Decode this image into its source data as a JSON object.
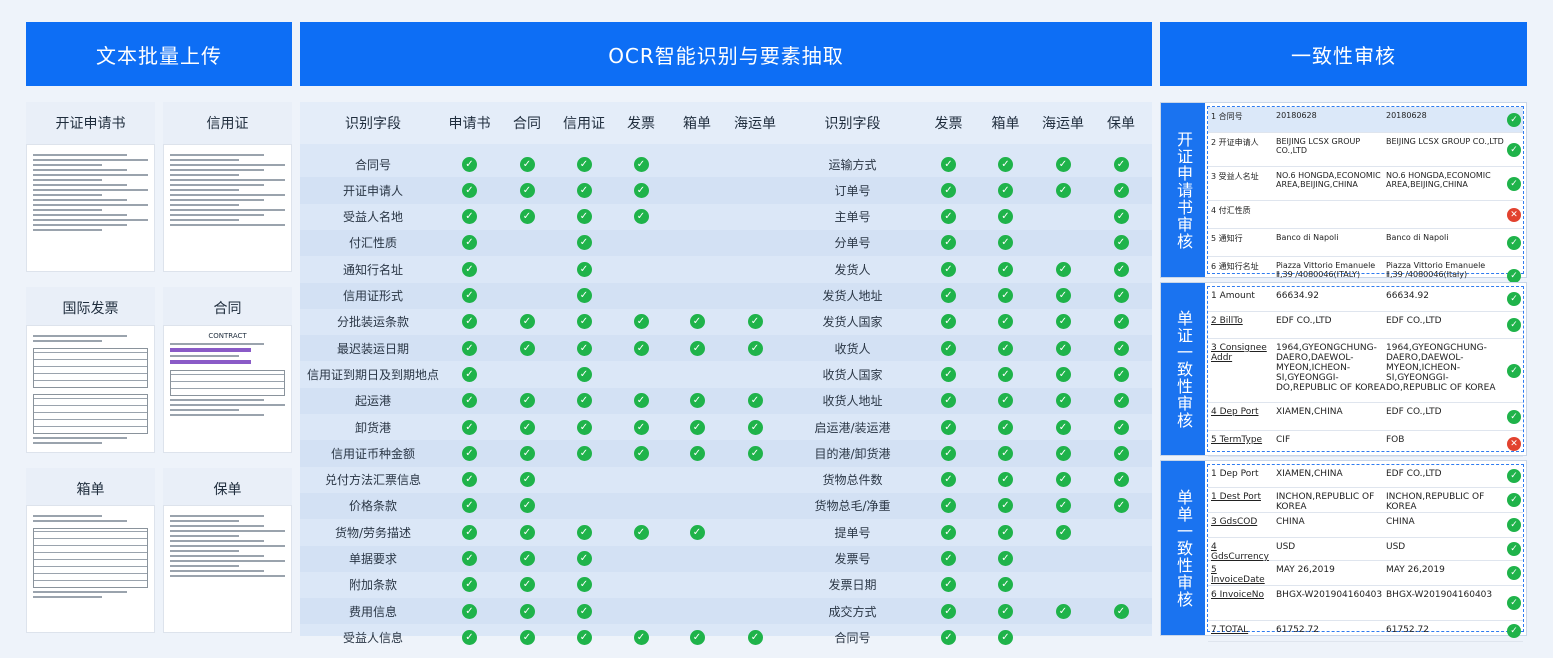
{
  "banners": {
    "upload": "文本批量上传",
    "ocr": "OCR智能识别与要素抽取",
    "review": "一致性审核"
  },
  "docs": [
    {
      "label": "开证申请书"
    },
    {
      "label": "信用证"
    },
    {
      "label": "国际发票"
    },
    {
      "label": "合同"
    },
    {
      "label": "箱单"
    },
    {
      "label": "保单"
    }
  ],
  "doc_text": {
    "contract_title": "CONTRACT"
  },
  "left_table": {
    "headers": [
      "识别字段",
      "申请书",
      "合同",
      "信用证",
      "发票",
      "箱单",
      "海运单"
    ],
    "rows": [
      {
        "field": "合同号",
        "checks": [
          1,
          1,
          1,
          1,
          0,
          0
        ]
      },
      {
        "field": "开证申请人",
        "checks": [
          1,
          1,
          1,
          1,
          0,
          0
        ]
      },
      {
        "field": "受益人名地",
        "checks": [
          1,
          1,
          1,
          1,
          0,
          0
        ]
      },
      {
        "field": "付汇性质",
        "checks": [
          1,
          0,
          1,
          0,
          0,
          0
        ]
      },
      {
        "field": "通知行名址",
        "checks": [
          1,
          0,
          1,
          0,
          0,
          0
        ]
      },
      {
        "field": "信用证形式",
        "checks": [
          1,
          0,
          1,
          0,
          0,
          0
        ]
      },
      {
        "field": "分批装运条款",
        "checks": [
          1,
          1,
          1,
          1,
          1,
          1
        ]
      },
      {
        "field": "最迟装运日期",
        "checks": [
          1,
          1,
          1,
          1,
          1,
          1
        ]
      },
      {
        "field": "信用证到期日及到期地点",
        "checks": [
          1,
          0,
          1,
          0,
          0,
          0
        ]
      },
      {
        "field": "起运港",
        "checks": [
          1,
          1,
          1,
          1,
          1,
          1
        ]
      },
      {
        "field": "卸货港",
        "checks": [
          1,
          1,
          1,
          1,
          1,
          1
        ]
      },
      {
        "field": "信用证币种金额",
        "checks": [
          1,
          1,
          1,
          1,
          1,
          1
        ]
      },
      {
        "field": "兑付方法汇票信息",
        "checks": [
          1,
          1,
          0,
          0,
          0,
          0
        ]
      },
      {
        "field": "价格条款",
        "checks": [
          1,
          1,
          0,
          0,
          0,
          0
        ]
      },
      {
        "field": "货物/劳务描述",
        "checks": [
          1,
          1,
          1,
          1,
          1,
          0
        ]
      },
      {
        "field": "单据要求",
        "checks": [
          1,
          1,
          1,
          0,
          0,
          0
        ]
      },
      {
        "field": "附加条款",
        "checks": [
          1,
          1,
          1,
          0,
          0,
          0
        ]
      },
      {
        "field": "费用信息",
        "checks": [
          1,
          1,
          1,
          0,
          0,
          0
        ]
      },
      {
        "field": "受益人信息",
        "checks": [
          1,
          1,
          1,
          1,
          1,
          1
        ]
      }
    ]
  },
  "right_table": {
    "headers": [
      "识别字段",
      "发票",
      "箱单",
      "海运单",
      "保单"
    ],
    "rows": [
      {
        "field": "运输方式",
        "checks": [
          1,
          1,
          1,
          1
        ]
      },
      {
        "field": "订单号",
        "checks": [
          1,
          1,
          1,
          1
        ]
      },
      {
        "field": "主单号",
        "checks": [
          1,
          1,
          0,
          1
        ]
      },
      {
        "field": "分单号",
        "checks": [
          1,
          1,
          0,
          1
        ]
      },
      {
        "field": "发货人",
        "checks": [
          1,
          1,
          1,
          1
        ]
      },
      {
        "field": "发货人地址",
        "checks": [
          1,
          1,
          1,
          1
        ]
      },
      {
        "field": "发货人国家",
        "checks": [
          1,
          1,
          1,
          1
        ]
      },
      {
        "field": "收货人",
        "checks": [
          1,
          1,
          1,
          1
        ]
      },
      {
        "field": "收货人国家",
        "checks": [
          1,
          1,
          1,
          1
        ]
      },
      {
        "field": "收货人地址",
        "checks": [
          1,
          1,
          1,
          1
        ]
      },
      {
        "field": "启运港/装运港",
        "checks": [
          1,
          1,
          1,
          1
        ]
      },
      {
        "field": "目的港/卸货港",
        "checks": [
          1,
          1,
          1,
          1
        ]
      },
      {
        "field": "货物总件数",
        "checks": [
          1,
          1,
          1,
          1
        ]
      },
      {
        "field": "货物总毛/净重",
        "checks": [
          1,
          1,
          1,
          1
        ]
      },
      {
        "field": "提单号",
        "checks": [
          1,
          1,
          1,
          0
        ]
      },
      {
        "field": "发票号",
        "checks": [
          1,
          1,
          0,
          0
        ]
      },
      {
        "field": "发票日期",
        "checks": [
          1,
          1,
          0,
          0
        ]
      },
      {
        "field": "成交方式",
        "checks": [
          1,
          1,
          1,
          1
        ]
      },
      {
        "field": "合同号",
        "checks": [
          1,
          1,
          0,
          0
        ]
      }
    ]
  },
  "panels": [
    {
      "title": "开证申请书审核",
      "rows": [
        {
          "field": "1 合同号",
          "v1": "20180628",
          "v2": "20180628",
          "status": "ok",
          "hl": true
        },
        {
          "field": "2 开证申请人",
          "v1": "BEIJING LCSX GROUP CO.,LTD",
          "v2": "BEIJING LCSX GROUP CO.,LTD",
          "status": "ok"
        },
        {
          "field": "3 受益人名址",
          "v1": "NO.6 HONGDA,ECONOMIC AREA,BEIJING,CHINA",
          "v2": "NO.6 HONGDA,ECONOMIC AREA,BEIJING,CHINA",
          "status": "ok"
        },
        {
          "field": "4 付汇性质",
          "v1": "",
          "v2": "",
          "status": "bad"
        },
        {
          "field": "5 通知行",
          "v1": "Banco di Napoli",
          "v2": "Banco di Napoli",
          "status": "ok"
        },
        {
          "field": "6 通知行名址",
          "v1": "Piazza Vittorio Emanuele Ⅱ,39 /4080046(ITALY)",
          "v2": "Piazza Vittorio Emanuele Ⅱ,39 /4080046(Italy)",
          "status": "ok"
        }
      ]
    },
    {
      "title": "单证一致性审核",
      "rows": [
        {
          "field": "1 Amount",
          "v1": "66634.92",
          "v2": "66634.92",
          "status": "ok"
        },
        {
          "field": "2 BillTo",
          "v1": "EDF CO.,LTD",
          "v2": "EDF CO.,LTD",
          "status": "ok"
        },
        {
          "field": "3 Consignee Addr",
          "v1": "1964,GYEONGCHUNG-DAERO,DAEWOL-MYEON,ICHEON-SI,GYEONGGI-DO,REPUBLIC OF KOREA",
          "v2": "1964,GYEONGCHUNG-DAERO,DAEWOL-MYEON,ICHEON-SI,GYEONGGI-DO,REPUBLIC OF KOREA",
          "status": "ok"
        },
        {
          "field": "4 Dep Port",
          "v1": "XIAMEN,CHINA",
          "v2": "EDF CO.,LTD",
          "status": "ok"
        },
        {
          "field": "5 TermType",
          "v1": "CIF",
          "v2": "FOB",
          "status": "bad"
        }
      ]
    },
    {
      "title": "单单一致性审核",
      "rows": [
        {
          "field": "1 Dep Port",
          "v1": "XIAMEN,CHINA",
          "v2": "EDF CO.,LTD",
          "status": "ok"
        },
        {
          "field": "1 Dest Port",
          "v1": "INCHON,REPUBLIC OF KOREA",
          "v2": "INCHON,REPUBLIC OF KOREA",
          "status": "ok"
        },
        {
          "field": "3 GdsCOD",
          "v1": "CHINA",
          "v2": "CHINA",
          "status": "ok"
        },
        {
          "field": "4 GdsCurrency",
          "v1": "USD",
          "v2": "USD",
          "status": "ok"
        },
        {
          "field": "5 InvoiceDate",
          "v1": "MAY 26,2019",
          "v2": "MAY 26,2019",
          "status": "ok"
        },
        {
          "field": "6 InvoiceNo",
          "v1": "BHGX-W201904160403",
          "v2": "BHGX-W201904160403",
          "status": "ok"
        },
        {
          "field": "7 TOTAL",
          "v1": "61752.72",
          "v2": "61752.72",
          "status": "ok"
        }
      ]
    }
  ],
  "icons": {
    "check": "check-circle-icon",
    "cross": "x-circle-icon"
  },
  "colors": {
    "brand": "#0d6ef5",
    "ok": "#1fb34a",
    "bad": "#e2422f"
  }
}
